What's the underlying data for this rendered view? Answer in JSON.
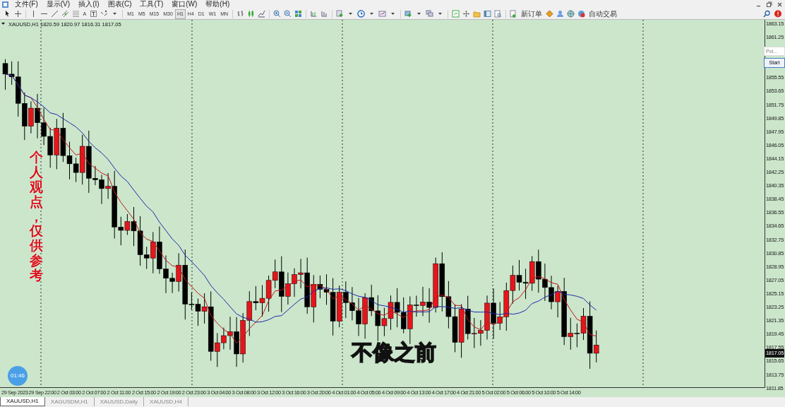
{
  "menu": [
    "文件(F)",
    "显示(V)",
    "插入(I)",
    "图表(C)",
    "工具(T)",
    "窗口(W)",
    "帮助(H)"
  ],
  "toolbar": {
    "text_tool": "A",
    "timeframes": [
      {
        "label": "M1",
        "selected": false
      },
      {
        "label": "M5",
        "selected": false
      },
      {
        "label": "M15",
        "selected": false
      },
      {
        "label": "M30",
        "selected": false
      },
      {
        "label": "H1",
        "selected": true
      },
      {
        "label": "H4",
        "selected": false
      },
      {
        "label": "D1",
        "selected": false
      },
      {
        "label": "W1",
        "selected": false
      },
      {
        "label": "MN",
        "selected": false
      }
    ],
    "new_order": "新订单",
    "auto_trading": "自动交易"
  },
  "chart": {
    "header": "XAUUSD,H1  1820.59 1820.97 1816.31 1817.05",
    "price_labels": [
      "1863.15",
      "1861.25",
      "1855.55",
      "1853.65",
      "1851.75",
      "1849.85",
      "1847.95",
      "1846.05",
      "1844.15",
      "1842.25",
      "1840.35",
      "1838.45",
      "1836.55",
      "1834.65",
      "1832.75",
      "1830.85",
      "1828.95",
      "1827.05",
      "1825.15",
      "1823.25",
      "1821.35",
      "1819.45",
      "1817.55",
      "1815.65",
      "1813.75",
      "1811.85"
    ],
    "current_price": "1817.05",
    "time_labels": [
      "29 Sep 2023",
      "29 Sep 22:00",
      "2 Oct 03:00",
      "2 Oct 07:00",
      "2 Oct 11:00",
      "2 Oct 15:00",
      "2 Oct 19:00",
      "2 Oct 23:00",
      "3 Oct 04:00",
      "3 Oct 08:00",
      "3 Oct 12:00",
      "3 Oct 16:00",
      "3 Oct 20:00",
      "4 Oct 01:00",
      "4 Oct 05:00",
      "4 Oct 09:00",
      "4 Oct 13:00",
      "4 Oct 17:00",
      "4 Oct 21:00",
      "5 Oct 02:00",
      "5 Oct 06:00",
      "5 Oct 10:00",
      "5 Oct 14:00"
    ]
  },
  "side_panel": {
    "placeholder": "Poi...",
    "button": "Start"
  },
  "tabs": [
    {
      "label": "XAUUSD,H1",
      "selected": true
    },
    {
      "label": "XAGUSDM,H1",
      "selected": false
    },
    {
      "label": "XAUUSD,Daily",
      "selected": false
    },
    {
      "label": "XAUUSD,H4",
      "selected": false
    }
  ],
  "overlay": {
    "side_caption": "个人观点，仅供参考",
    "caption": "不像之前",
    "timer": "01:46"
  }
}
